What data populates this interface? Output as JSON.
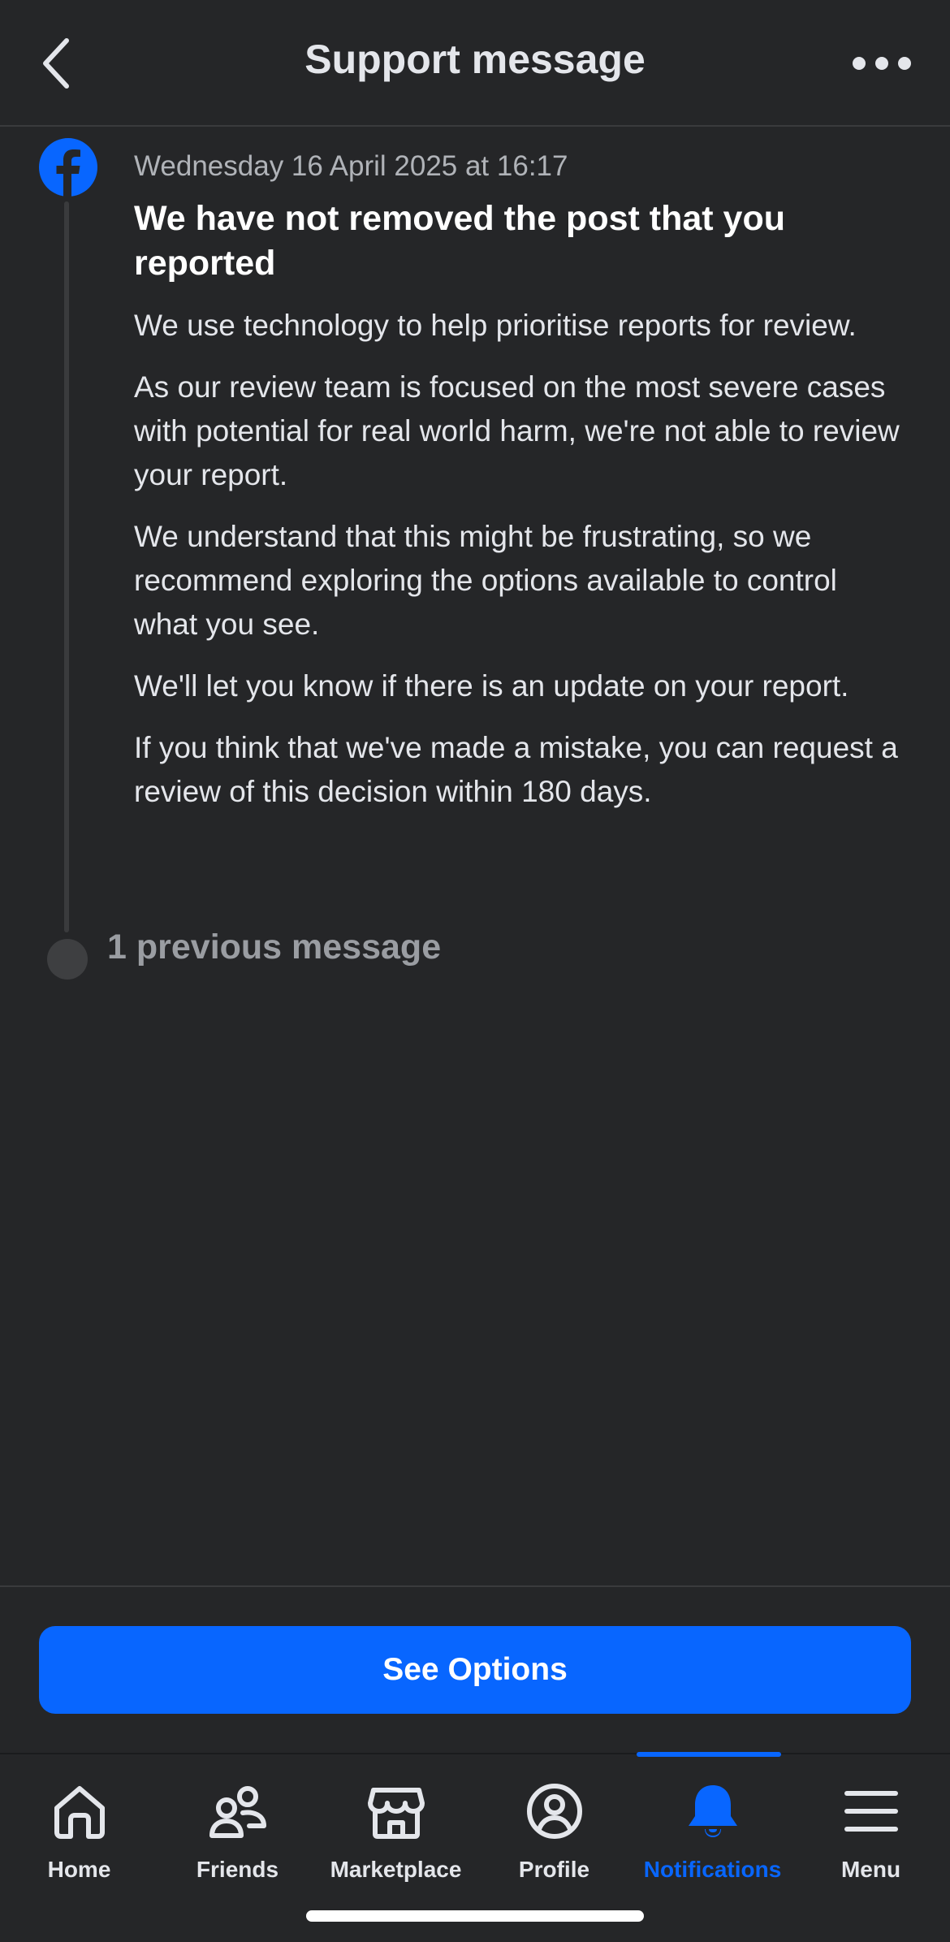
{
  "header": {
    "title": "Support message",
    "back_icon": "chevron-left-icon",
    "more_icon": "more-horizontal-icon"
  },
  "message": {
    "sender_icon": "facebook-logo-icon",
    "timestamp": "Wednesday 16 April 2025 at 16:17",
    "title": "We have not removed the post that you reported",
    "paragraphs": [
      "We use technology to help prioritise reports for review.",
      "As our review team is focused on the most severe cases with potential for real world harm, we're not able to review your report.",
      "We understand that this might be frustrating, so we recommend exploring the options available to control what you see.",
      "We'll let you know if there is an update on your report.",
      "If you think that we've made a mistake, you can request a review of this decision within 180 days."
    ]
  },
  "previous_messages": {
    "label": "1 previous message"
  },
  "action": {
    "label": "See Options"
  },
  "tabs": [
    {
      "label": "Home",
      "icon": "home-icon"
    },
    {
      "label": "Friends",
      "icon": "friends-icon"
    },
    {
      "label": "Marketplace",
      "icon": "marketplace-icon"
    },
    {
      "label": "Profile",
      "icon": "profile-icon"
    },
    {
      "label": "Notifications",
      "icon": "bell-icon",
      "active": true
    },
    {
      "label": "Menu",
      "icon": "menu-icon"
    }
  ],
  "colors": {
    "background": "#252628",
    "accent": "#0866ff",
    "text_primary": "#e4e6eb",
    "text_secondary": "#b0b3b8"
  }
}
